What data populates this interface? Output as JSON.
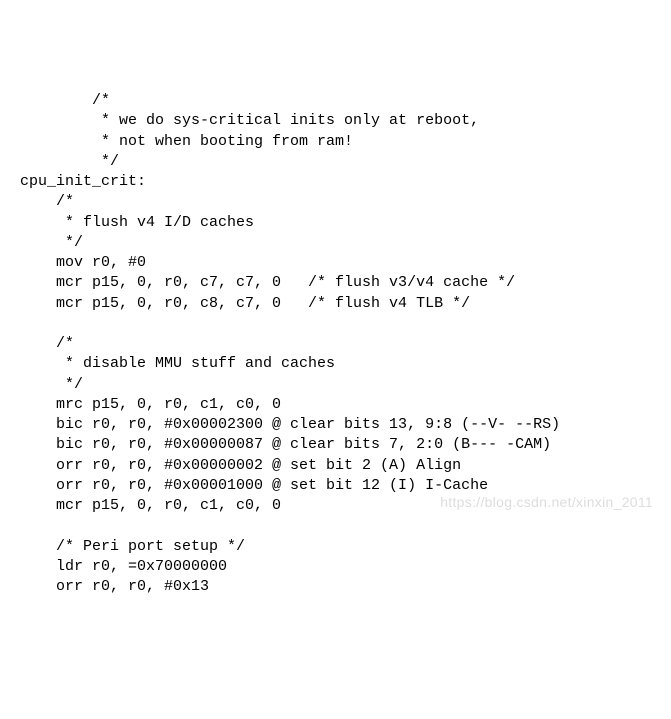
{
  "code": {
    "lines": [
      "        /*",
      "         * we do sys-critical inits only at reboot,",
      "         * not when booting from ram!",
      "         */",
      "cpu_init_crit:",
      "    /*",
      "     * flush v4 I/D caches",
      "     */",
      "    mov r0, #0",
      "    mcr p15, 0, r0, c7, c7, 0   /* flush v3/v4 cache */",
      "    mcr p15, 0, r0, c8, c7, 0   /* flush v4 TLB */",
      "",
      "    /*",
      "     * disable MMU stuff and caches",
      "     */",
      "    mrc p15, 0, r0, c1, c0, 0",
      "    bic r0, r0, #0x00002300 @ clear bits 13, 9:8 (--V- --RS)",
      "    bic r0, r0, #0x00000087 @ clear bits 7, 2:0 (B--- -CAM)",
      "    orr r0, r0, #0x00000002 @ set bit 2 (A) Align",
      "    orr r0, r0, #0x00001000 @ set bit 12 (I) I-Cache",
      "    mcr p15, 0, r0, c1, c0, 0",
      "",
      "    /* Peri port setup */",
      "    ldr r0, =0x70000000",
      "    orr r0, r0, #0x13"
    ]
  },
  "watermark": "https://blog.csdn.net/xinxin_2011"
}
